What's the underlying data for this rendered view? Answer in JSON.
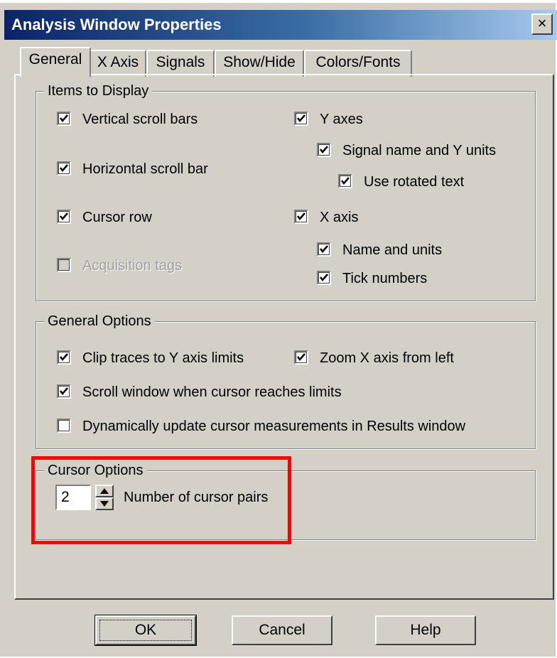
{
  "window": {
    "title": "Analysis Window Properties",
    "close_glyph": "×"
  },
  "tabs": [
    {
      "label": "General",
      "active": true
    },
    {
      "label": "X Axis"
    },
    {
      "label": "Signals"
    },
    {
      "label": "Show/Hide"
    },
    {
      "label": "Colors/Fonts"
    }
  ],
  "items_to_display": {
    "legend": "Items to Display",
    "vertical_scroll_bars": {
      "label": "Vertical scroll bars",
      "checked": true
    },
    "horizontal_scroll_bar": {
      "label": "Horizontal scroll bar",
      "checked": true
    },
    "cursor_row": {
      "label": "Cursor row",
      "checked": true
    },
    "acquisition_tags": {
      "label": "Acquisition tags",
      "checked": false,
      "disabled": true
    },
    "y_axes": {
      "label": "Y axes",
      "checked": true
    },
    "signal_name_y_units": {
      "label": "Signal name and Y units",
      "checked": true
    },
    "use_rotated_text": {
      "label": "Use rotated text",
      "checked": true
    },
    "x_axis": {
      "label": "X axis",
      "checked": true
    },
    "name_and_units": {
      "label": "Name and units",
      "checked": true
    },
    "tick_numbers": {
      "label": "Tick numbers",
      "checked": true
    }
  },
  "general_options": {
    "legend": "General Options",
    "clip_traces": {
      "label": "Clip traces to Y axis limits",
      "checked": true
    },
    "zoom_x_from_left": {
      "label": "Zoom X axis from left",
      "checked": true
    },
    "scroll_window": {
      "label": "Scroll window when cursor reaches limits",
      "checked": true
    },
    "dynamic_update": {
      "label": "Dynamically update cursor measurements in Results window",
      "checked": false
    }
  },
  "cursor_options": {
    "legend": "Cursor Options",
    "cursor_pairs_value": "2",
    "cursor_pairs_label": "Number of cursor pairs"
  },
  "buttons": {
    "ok": "OK",
    "cancel": "Cancel",
    "help": "Help"
  },
  "colors": {
    "title_start": "#0a246a",
    "title_end": "#a6caf0",
    "face": "#d4d0c8",
    "highlight": "#ff0000"
  }
}
